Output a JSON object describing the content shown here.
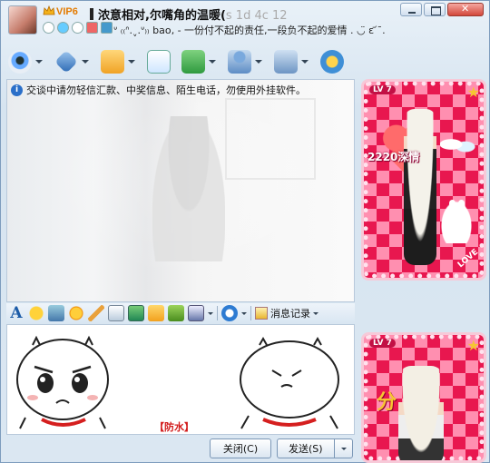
{
  "titlebar": {
    "vip_label": "VIP6",
    "contact_name": "浓意相对,尔嘴角的温暖(",
    "contact_name_obscured": "s 1d 4c 12",
    "signature": "ᐡ ₍₍ᐢ.ˬ.ᐡ₎₎ bao‚ - 一份付不起的责任,一段负不起的爱情 . ◡̈ ε ᷄ˉ.",
    "controls": [
      "minimize",
      "maximize",
      "close"
    ]
  },
  "toolbar": {
    "items": [
      {
        "name": "video-call",
        "icon": "webcam-icon"
      },
      {
        "name": "voice-call",
        "icon": "microphone-icon"
      },
      {
        "name": "send-file",
        "icon": "folder-icon"
      },
      {
        "name": "send-mail",
        "icon": "mail-icon"
      },
      {
        "name": "apps",
        "icon": "app-add-icon"
      },
      {
        "name": "friend",
        "icon": "user-icon"
      },
      {
        "name": "settings",
        "icon": "settings-icon"
      },
      {
        "name": "game",
        "icon": "game-icon"
      }
    ]
  },
  "chat": {
    "notice": "交谈中请勿轻信汇款、中奖信息、陌生电话，勿使用外挂软件。"
  },
  "format_toolbar": {
    "history_label": "消息记录"
  },
  "input": {
    "anti_label": "【防水】"
  },
  "buttons": {
    "close_label": "关闭(C)",
    "send_label": "发送(S)"
  },
  "show_panel": {
    "level_top": "LV 7",
    "score_text": "2220深情",
    "love_text": "LOVE",
    "level_bottom": "LV 7",
    "bottom_text": "分"
  },
  "colors": {
    "accent": "#2a6fc9",
    "anti_red": "#d21b1b",
    "panel_pink": "#e8174f"
  }
}
